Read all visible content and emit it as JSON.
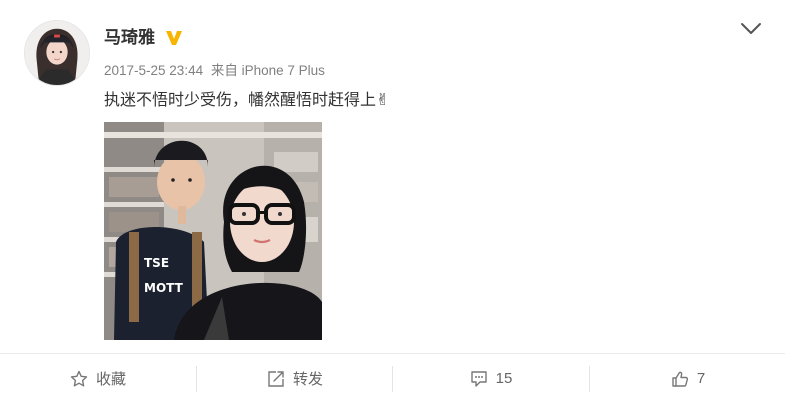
{
  "post": {
    "username": "马琦雅",
    "verified_badge_color": "#f8b500",
    "timestamp": "2017-5-25 23:44",
    "source": "来自 iPhone 7 Plus",
    "text": "执迷不悟时少受伤，幡然醒悟时赶得上",
    "text_emoji": "✌"
  },
  "actions": {
    "favorite_label": "收藏",
    "repost_label": "转发",
    "comment_count": "15",
    "like_count": "7"
  },
  "icons": {
    "menu": "chevron-down-icon",
    "favorite": "star-icon",
    "repost": "share-icon",
    "comment": "comment-icon",
    "like": "thumbs-up-icon",
    "verified": "verified-v-icon"
  },
  "colors": {
    "text": "#333333",
    "meta": "#808080",
    "action_text": "#666666",
    "divider": "#ebebeb"
  }
}
